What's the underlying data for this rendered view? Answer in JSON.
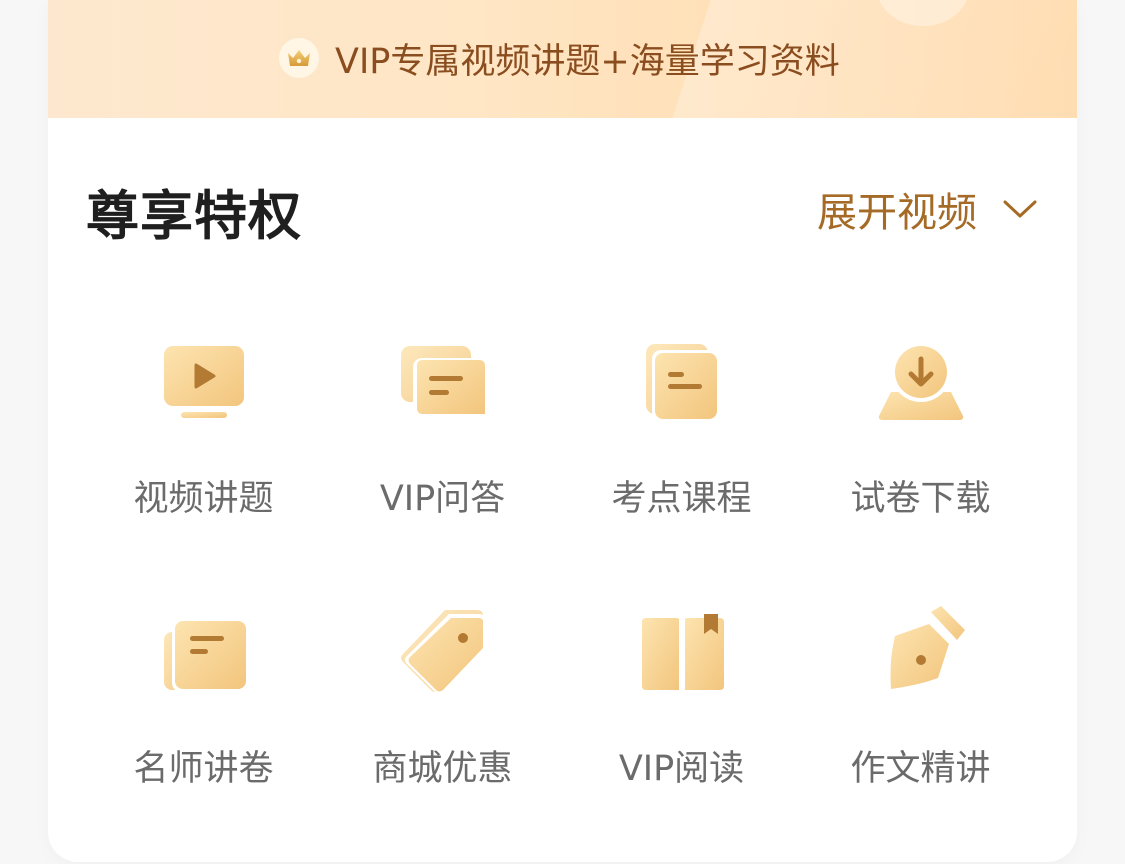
{
  "banner": {
    "text": "VIP专属视频讲题+海量学习资料",
    "icon": "crown-icon"
  },
  "section": {
    "title": "尊享特权",
    "expand_label": "展开视频",
    "expand_icon": "chevron-down-icon"
  },
  "colors": {
    "accent": "#a56b26",
    "banner_text": "#8a4d1f",
    "icon_gold_light": "#fde4b0",
    "icon_gold_dark": "#f2c57d"
  },
  "privileges": [
    {
      "label": "视频讲题",
      "icon": "video-play-icon"
    },
    {
      "label": "VIP问答",
      "icon": "chat-bubbles-icon"
    },
    {
      "label": "考点课程",
      "icon": "course-notes-icon"
    },
    {
      "label": "试卷下载",
      "icon": "download-icon"
    },
    {
      "label": "名师讲卷",
      "icon": "lecture-paper-icon"
    },
    {
      "label": "商城优惠",
      "icon": "price-tag-icon"
    },
    {
      "label": "VIP阅读",
      "icon": "open-book-icon"
    },
    {
      "label": "作文精讲",
      "icon": "pen-nib-icon"
    }
  ]
}
